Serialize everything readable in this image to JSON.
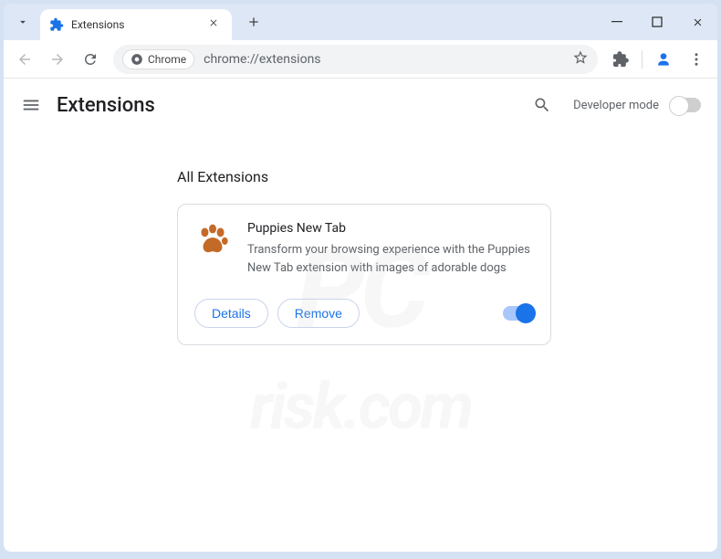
{
  "tab": {
    "title": "Extensions"
  },
  "addressbar": {
    "chip_label": "Chrome",
    "url": "chrome://extensions"
  },
  "header": {
    "title": "Extensions",
    "dev_mode_label": "Developer mode",
    "dev_mode_enabled": false
  },
  "content": {
    "section_title": "All Extensions"
  },
  "extension": {
    "name": "Puppies New Tab",
    "description": "Transform your browsing experience with the Puppies New Tab extension with images of adorable dogs",
    "details_label": "Details",
    "remove_label": "Remove",
    "enabled": true,
    "icon_name": "paw-icon",
    "icon_color": "#c46a28"
  },
  "watermark": {
    "line1": "PC",
    "line2": "risk.com"
  }
}
